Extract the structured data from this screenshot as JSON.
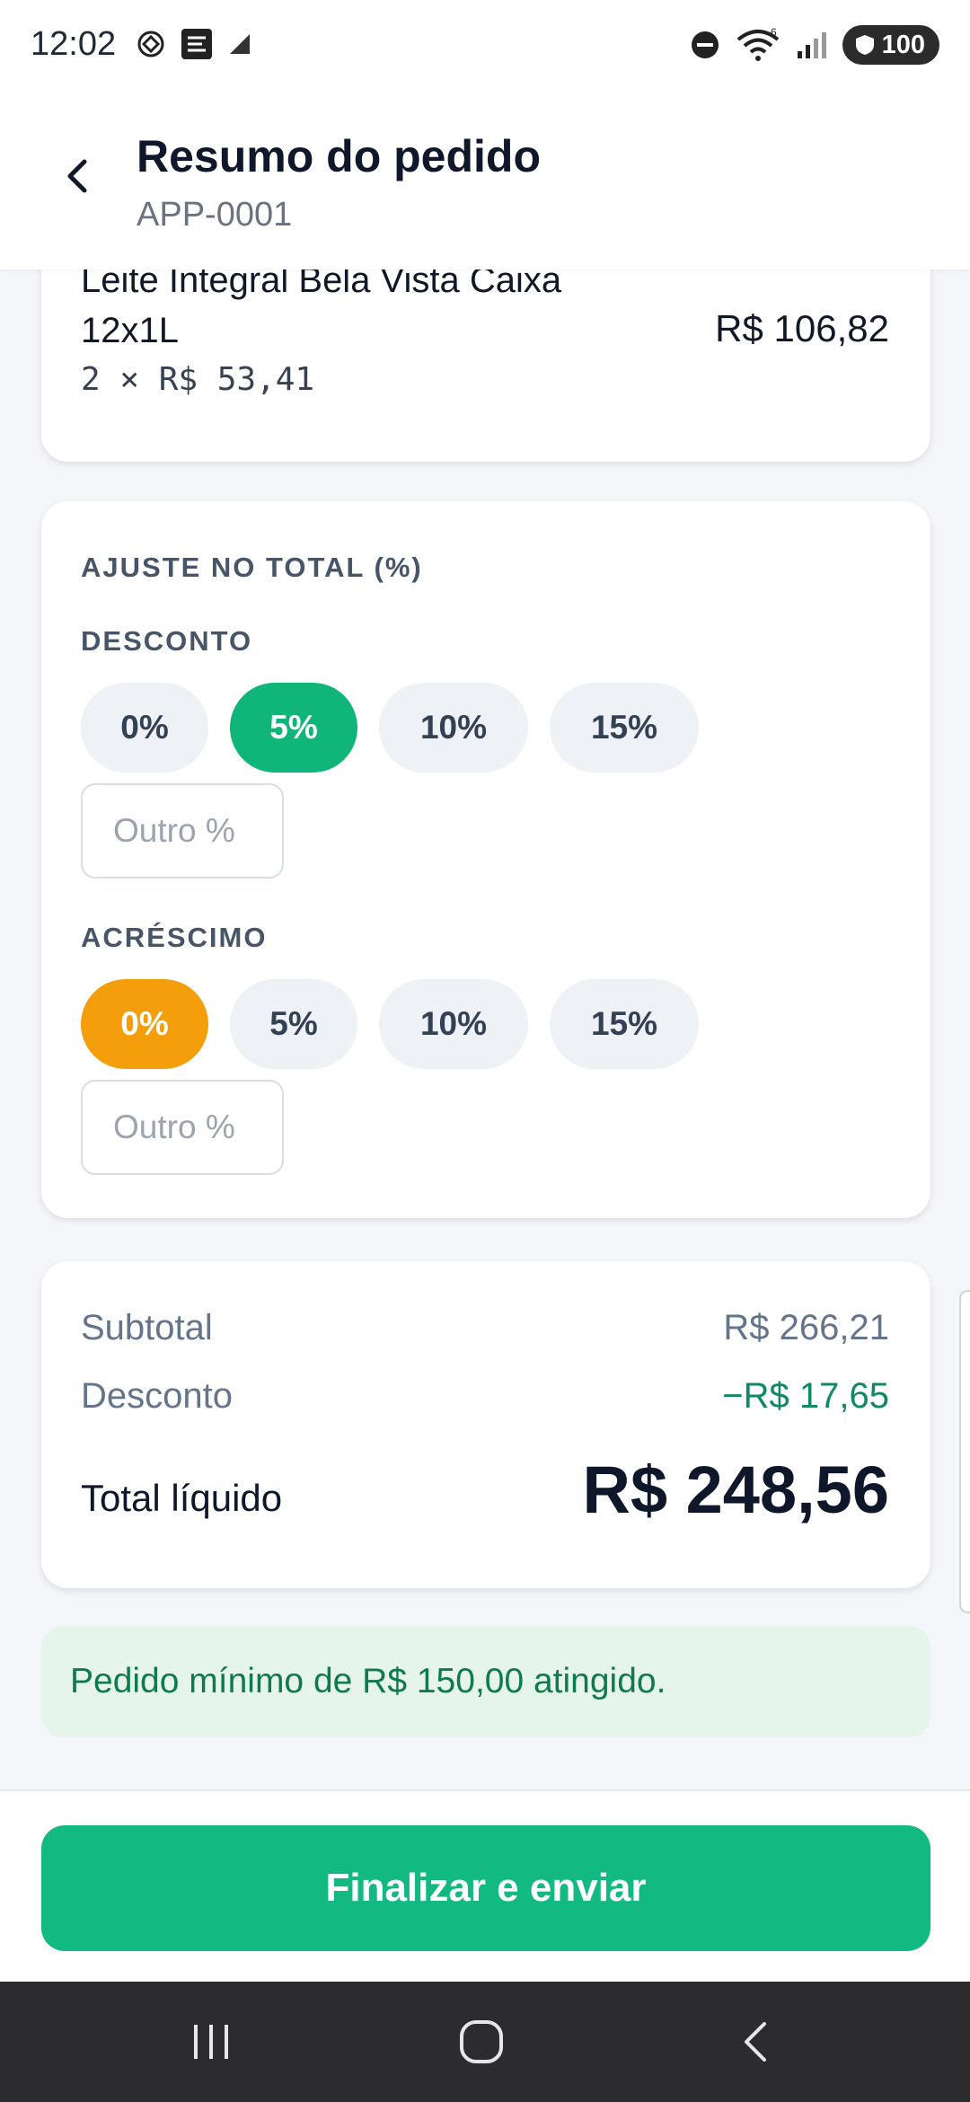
{
  "status_bar": {
    "time": "12:02",
    "wifi_badge": "6",
    "battery": "100",
    "left_icons": [
      "openai-icon",
      "app-icon",
      "signal-app-icon"
    ],
    "right_icons": [
      "dnd-icon",
      "wifi-icon",
      "cell-signal-icon",
      "battery-icon"
    ]
  },
  "header": {
    "title": "Resumo do pedido",
    "subtitle": "APP-0001",
    "back_icon": "chevron-left-icon"
  },
  "item": {
    "name_line1": "Leite Integral Bela Vista Caixa",
    "name_line2": "12x1L",
    "quantity_line": "2 × R$ 53,41",
    "price": "R$ 106,82"
  },
  "adjust": {
    "title": "AJUSTE NO TOTAL (%)",
    "discount": {
      "label": "DESCONTO",
      "options": [
        "0%",
        "5%",
        "10%",
        "15%"
      ],
      "selected": "5%",
      "other_placeholder": "Outro %"
    },
    "surcharge": {
      "label": "ACRÉSCIMO",
      "options": [
        "0%",
        "5%",
        "10%",
        "15%"
      ],
      "selected": "0%",
      "other_placeholder": "Outro %"
    }
  },
  "totals": {
    "subtotal_label": "Subtotal",
    "subtotal_value": "R$ 266,21",
    "discount_label": "Desconto",
    "discount_value": "−R$ 17,65",
    "net_label": "Total líquido",
    "net_value": "R$ 248,56"
  },
  "notice": "Pedido mínimo de R$ 150,00 atingido.",
  "action": {
    "finalize_label": "Finalizar e enviar"
  },
  "colors": {
    "accent_green": "#12b981",
    "accent_orange": "#f59e0b",
    "discount_text": "#0f8a5f"
  },
  "nav": [
    "recent-apps-icon",
    "home-icon",
    "back-icon"
  ]
}
